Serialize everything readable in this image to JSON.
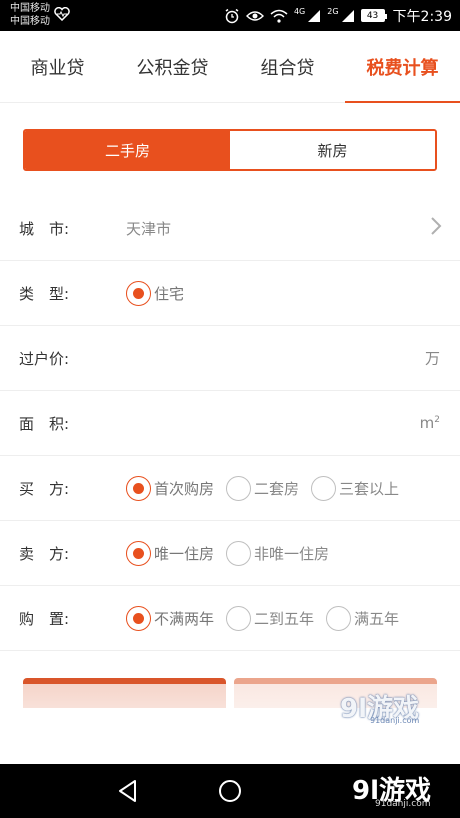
{
  "status_bar": {
    "carrier1": "中国移动",
    "carrier2": "中国移动",
    "network_4g": "4G",
    "network_2g": "2G",
    "battery": "43",
    "time": "下午2:39"
  },
  "tabs": [
    {
      "label": "商业贷",
      "active": false
    },
    {
      "label": "公积金贷",
      "active": false
    },
    {
      "label": "组合贷",
      "active": false
    },
    {
      "label": "税费计算",
      "active": true
    }
  ],
  "segment": {
    "options": [
      "二手房",
      "新房"
    ],
    "selected": "二手房"
  },
  "form": {
    "city": {
      "label": "城　市:",
      "value": "天津市"
    },
    "type": {
      "label": "类　型:",
      "options": [
        {
          "label": "住宅",
          "checked": true
        }
      ]
    },
    "price": {
      "label": "过户价:",
      "unit": "万"
    },
    "area": {
      "label": "面　积:",
      "unit": "m",
      "unit_sup": "2"
    },
    "buyer": {
      "label": "买　方:",
      "options": [
        {
          "label": "首次购房",
          "checked": true
        },
        {
          "label": "二套房",
          "checked": false
        },
        {
          "label": "三套以上",
          "checked": false
        }
      ]
    },
    "seller": {
      "label": "卖　方:",
      "options": [
        {
          "label": "唯一住房",
          "checked": true
        },
        {
          "label": "非唯一住房",
          "checked": false
        }
      ]
    },
    "purchase": {
      "label": "购　置:",
      "options": [
        {
          "label": "不满两年",
          "checked": true
        },
        {
          "label": "二到五年",
          "checked": false
        },
        {
          "label": "满五年",
          "checked": false
        }
      ]
    }
  },
  "watermark": {
    "logo": "9l游戏",
    "site": "91danji.com"
  },
  "colors": {
    "accent": "#e8501e",
    "accent_light": "#eba58c"
  }
}
